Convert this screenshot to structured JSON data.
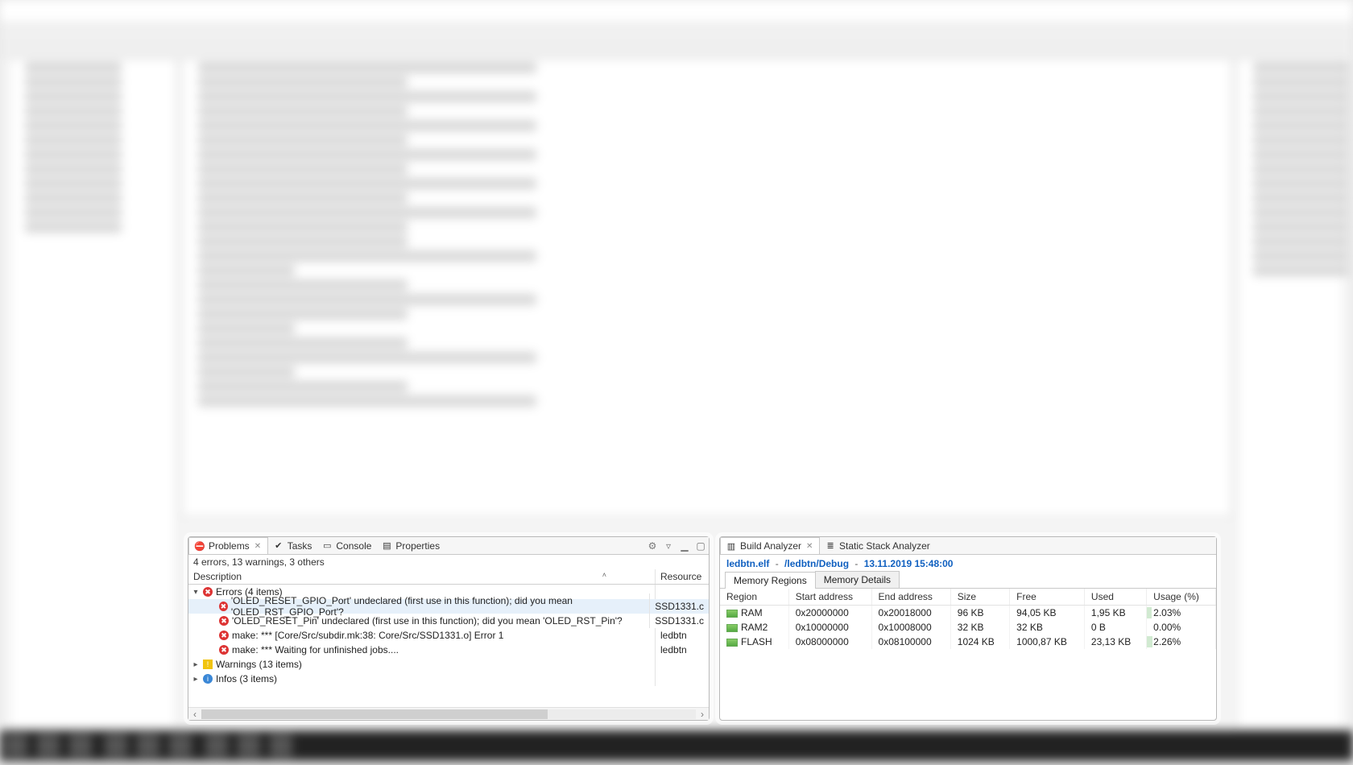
{
  "problems": {
    "tabs": {
      "problems": "Problems",
      "tasks": "Tasks",
      "console": "Console",
      "properties": "Properties"
    },
    "summary": "4 errors, 13 warnings, 3 others",
    "columns": {
      "description": "Description",
      "resource": "Resource"
    },
    "groups": {
      "errors": "Errors (4 items)",
      "warnings": "Warnings (13 items)",
      "infos": "Infos (3 items)"
    },
    "errors": [
      {
        "desc": "'OLED_RESET_GPIO_Port' undeclared (first use in this function); did you mean 'OLED_RST_GPIO_Port'?",
        "res": "SSD1331.c"
      },
      {
        "desc": "'OLED_RESET_Pin' undeclared (first use in this function); did you mean 'OLED_RST_Pin'?",
        "res": "SSD1331.c"
      },
      {
        "desc": "make: *** [Core/Src/subdir.mk:38: Core/Src/SSD1331.o] Error 1",
        "res": "ledbtn"
      },
      {
        "desc": "make: *** Waiting for unfinished jobs....",
        "res": "ledbtn"
      }
    ]
  },
  "build": {
    "tabs": {
      "analyzer": "Build Analyzer",
      "stack": "Static Stack Analyzer"
    },
    "elf": "ledbtn.elf",
    "path": "/ledbtn/Debug",
    "date": "13.11.2019 15:48:00",
    "subtabs": {
      "regions": "Memory Regions",
      "details": "Memory Details"
    },
    "columns": {
      "region": "Region",
      "start": "Start address",
      "end": "End address",
      "size": "Size",
      "free": "Free",
      "used": "Used",
      "usage": "Usage (%)"
    },
    "rows": [
      {
        "region": "RAM",
        "start": "0x20000000",
        "end": "0x20018000",
        "size": "96 KB",
        "free": "94,05 KB",
        "used": "1,95 KB",
        "usage": "2.03%"
      },
      {
        "region": "RAM2",
        "start": "0x10000000",
        "end": "0x10008000",
        "size": "32 KB",
        "free": "32 KB",
        "used": "0 B",
        "usage": "0.00%"
      },
      {
        "region": "FLASH",
        "start": "0x08000000",
        "end": "0x08100000",
        "size": "1024 KB",
        "free": "1000,87 KB",
        "used": "23,13 KB",
        "usage": "2.26%"
      }
    ]
  }
}
